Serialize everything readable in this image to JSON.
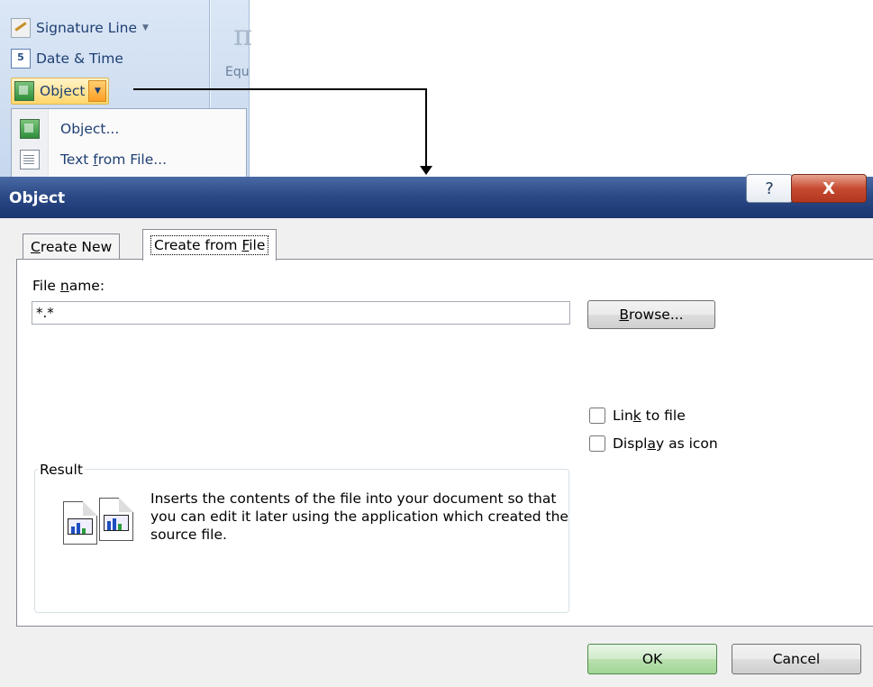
{
  "ribbon": {
    "signature_line": "Signature Line",
    "date_time": "Date & Time",
    "date_icon_text": "5",
    "object": "Object",
    "equation_partial": "Equ",
    "dropdown": {
      "object_item_pre": "Ob",
      "object_item_key": "j",
      "object_item_post": "ect...",
      "text_item_pre": "Text ",
      "text_item_key": "f",
      "text_item_post": "rom File..."
    }
  },
  "dialog": {
    "title": "Object",
    "help_glyph": "?",
    "close_glyph": "X",
    "tabs": {
      "create_new_key": "C",
      "create_new_rest": "reate New",
      "create_from_file_pre": "Create from ",
      "create_from_file_key": "F",
      "create_from_file_post": "ile"
    },
    "file_name_label_pre": "File ",
    "file_name_label_key": "n",
    "file_name_label_post": "ame:",
    "file_name_value": "*.*",
    "browse_key": "B",
    "browse_rest": "rowse...",
    "link_to_file_pre": "Lin",
    "link_to_file_key": "k",
    "link_to_file_post": " to file",
    "display_as_icon_pre": "Displ",
    "display_as_icon_key": "a",
    "display_as_icon_post": "y as icon",
    "result_label": "Result",
    "result_text": "Inserts the contents of the file into your document so that you can edit it later using the application which created the source file.",
    "ok": "OK",
    "cancel": "Cancel"
  },
  "colors": {
    "titlebar": "#2b4a86",
    "close_button": "#c64b31",
    "ok_button": "#b8e0ae",
    "ribbon_bg": "#cfdef1",
    "ribbon_text": "#1e3f73"
  }
}
